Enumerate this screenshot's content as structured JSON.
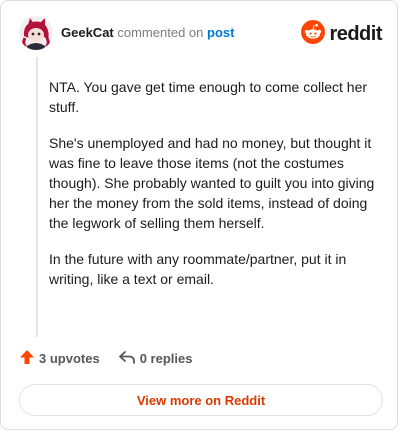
{
  "header": {
    "username": "GeekCat",
    "action_text": "commented on",
    "post_link": "post",
    "avatar_icon": "avatar-icon"
  },
  "brand": {
    "wordmark": "reddit",
    "logo_icon": "reddit-logo-icon",
    "logo_color": "#ff4500"
  },
  "comment": {
    "paragraphs": [
      "NTA. You gave get time enough to come collect her stuff.",
      "She's unemployed and had no money, but thought it was fine to leave those items (not the costumes though). She probably wanted to guilt you into giving her the money from the sold items, instead of doing the legwork of selling them herself.",
      "In the future with any roommate/partner, put it in writing, like a text or email."
    ]
  },
  "actions": {
    "upvotes_label": "3 upvotes",
    "upvote_icon": "upvote-arrow-icon",
    "upvote_color": "#ff4500",
    "replies_label": "0 replies",
    "reply_icon": "reply-icon"
  },
  "footer": {
    "view_more_label": "View more on Reddit",
    "accent_color": "#d93a00"
  }
}
